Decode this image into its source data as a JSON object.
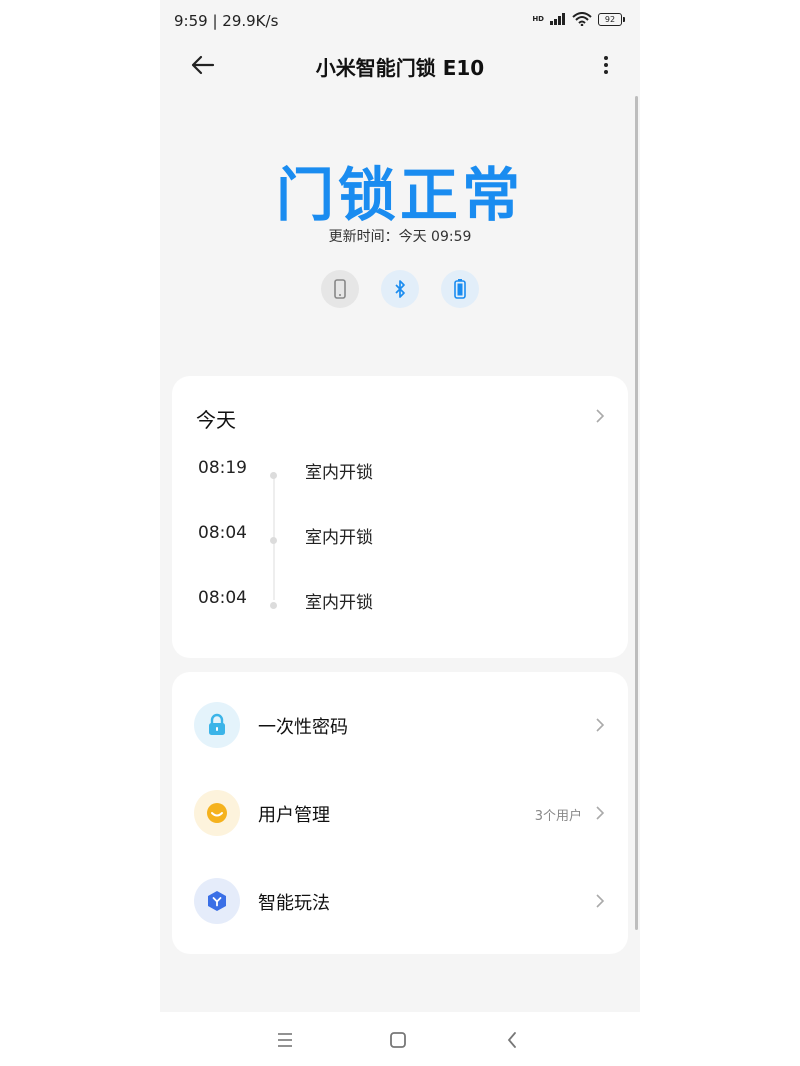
{
  "status_bar": {
    "time": "9:59 | 29.9K/s",
    "network_badge": "HD",
    "battery": "92",
    "icons": [
      "signal-icon",
      "wifi-icon",
      "battery-icon"
    ]
  },
  "header": {
    "title": "小米智能门锁 E10",
    "back_icon": "back-arrow-icon",
    "more_icon": "more-vertical-icon"
  },
  "hero": {
    "status": "门锁正常",
    "update_time": "更新时间：今天 09:59",
    "accent_color": "#1a8cf0",
    "indicators": [
      "phone-icon",
      "bluetooth-icon",
      "battery-status-icon"
    ]
  },
  "today": {
    "title": "今天",
    "events": [
      {
        "time": "08:19",
        "event": "室内开锁"
      },
      {
        "time": "08:04",
        "event": "室内开锁"
      },
      {
        "time": "08:04",
        "event": "室内开锁"
      }
    ]
  },
  "menu": {
    "items": [
      {
        "label": "一次性密码",
        "extra": "",
        "icon": "lock-icon"
      },
      {
        "label": "用户管理",
        "extra": "3个用户",
        "icon": "smiley-icon"
      },
      {
        "label": "智能玩法",
        "extra": "",
        "icon": "smart-hexagon-icon"
      }
    ]
  },
  "nav_bar": {
    "buttons": [
      "menu-lines-icon",
      "home-square-icon",
      "back-chevron-icon"
    ]
  }
}
